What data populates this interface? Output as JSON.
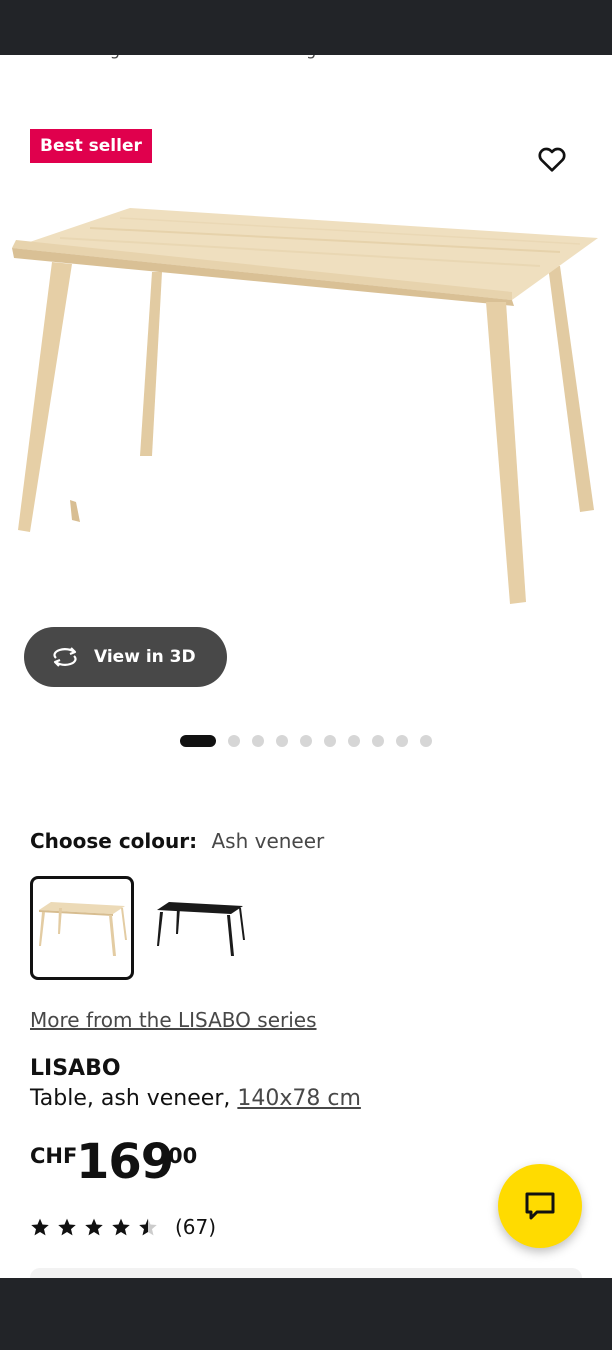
{
  "breadcrumb": [
    "...",
    "Dining tables",
    "Wooden dining tables"
  ],
  "badge": "Best seller",
  "view_3d": "View in 3D",
  "carousel": {
    "count": 11,
    "active_index": 0
  },
  "colour": {
    "label": "Choose colour:",
    "value": "Ash veneer"
  },
  "colour_options": [
    {
      "name": "Ash veneer",
      "hex": "#e8d3ab",
      "selected": true
    },
    {
      "name": "Black",
      "hex": "#1a1a1a",
      "selected": false
    }
  ],
  "series_link": "More from the LISABO series",
  "product": {
    "name": "LISABO",
    "desc_prefix": "Table, ash veneer, ",
    "dimensions": "140x78 cm"
  },
  "price": {
    "currency": "CHF",
    "integer": "169",
    "decimals": ".00"
  },
  "rating": {
    "stars": 4.5,
    "count": "(67)"
  },
  "colors": {
    "badge": "#e0004d",
    "chat": "#ffdb00",
    "button_dark": "#484848"
  },
  "icons": [
    "heart-icon",
    "rotate-3d-icon",
    "star-icon",
    "chat-icon"
  ]
}
